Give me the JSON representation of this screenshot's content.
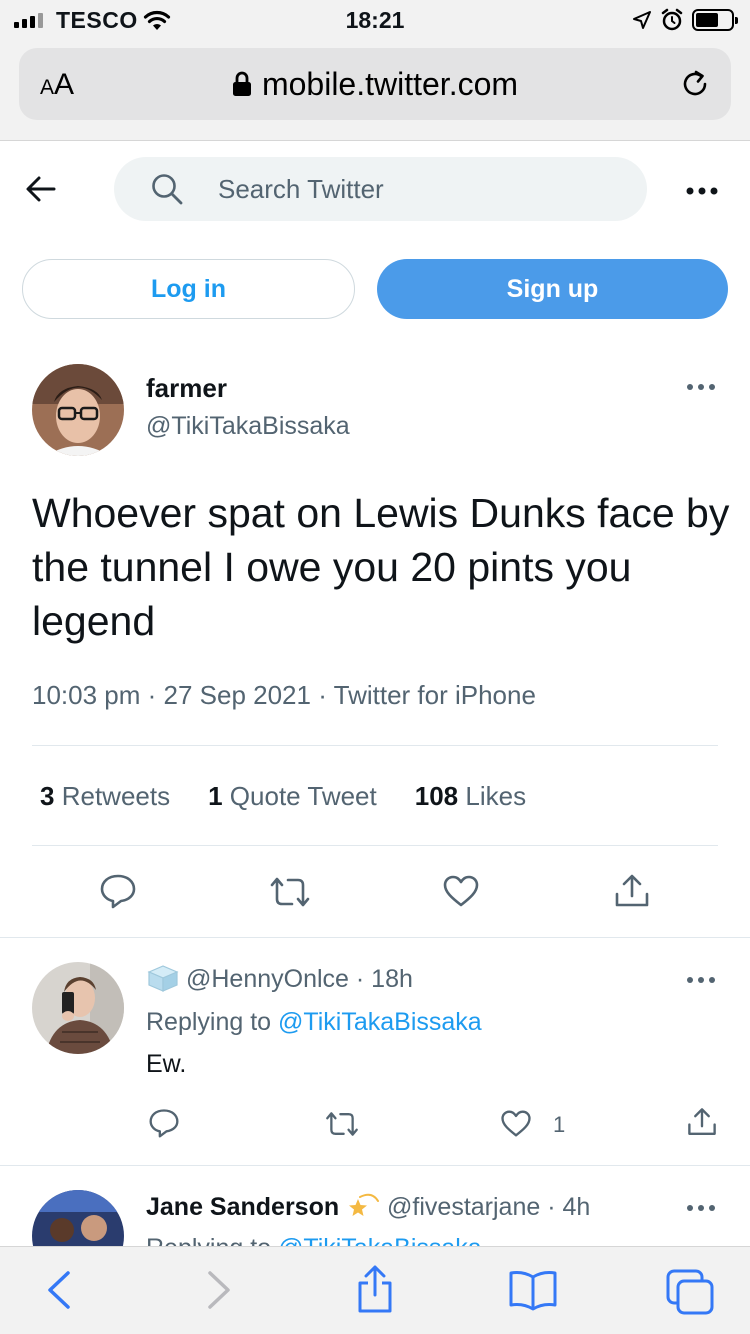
{
  "status_bar": {
    "carrier": "TESCO",
    "time": "18:21",
    "signal_bars": 4,
    "icons": [
      "signal-icon",
      "wifi-icon",
      "location-icon",
      "alarm-icon",
      "battery-icon"
    ]
  },
  "safari": {
    "text_size_button": {
      "small": "A",
      "large": "A"
    },
    "url": "mobile.twitter.com",
    "toolbar_icons": [
      "back-icon",
      "forward-icon",
      "share-icon",
      "bookmarks-icon",
      "tabs-icon"
    ]
  },
  "header": {
    "search_placeholder": "Search Twitter",
    "login_label": "Log in",
    "signup_label": "Sign up"
  },
  "tweet": {
    "display_name": "farmer",
    "handle": "@TikiTakaBissaka",
    "text": "Whoever spat on Lewis Dunks face by the tunnel I owe you 20 pints you legend",
    "meta": "10:03 pm · 27 Sep 2021 · Twitter for iPhone",
    "stats": [
      {
        "count": "3",
        "label": "Retweets"
      },
      {
        "count": "1",
        "label": "Quote Tweet"
      },
      {
        "count": "108",
        "label": "Likes"
      }
    ]
  },
  "replies": [
    {
      "emoji_icon": "ice-cube-icon",
      "handle": "@HennyOnlce",
      "time": "· 18h",
      "replying_prefix": "Replying to ",
      "replying_to": "@TikiTakaBissaka",
      "text": "Ew.",
      "like_count": "1"
    },
    {
      "display_name": "Jane Sanderson",
      "emoji_icon": "dizzy-star-icon",
      "handle": "@fivestarjane",
      "time": "· 4h",
      "replying_prefix": "Replying to ",
      "replying_to": "@TikiTakaBissaka"
    }
  ],
  "colors": {
    "twitter_blue": "#1d9bf0",
    "signup_bg": "#4b9be9",
    "secondary_text": "#536471",
    "safari_blue": "#3478f6"
  }
}
